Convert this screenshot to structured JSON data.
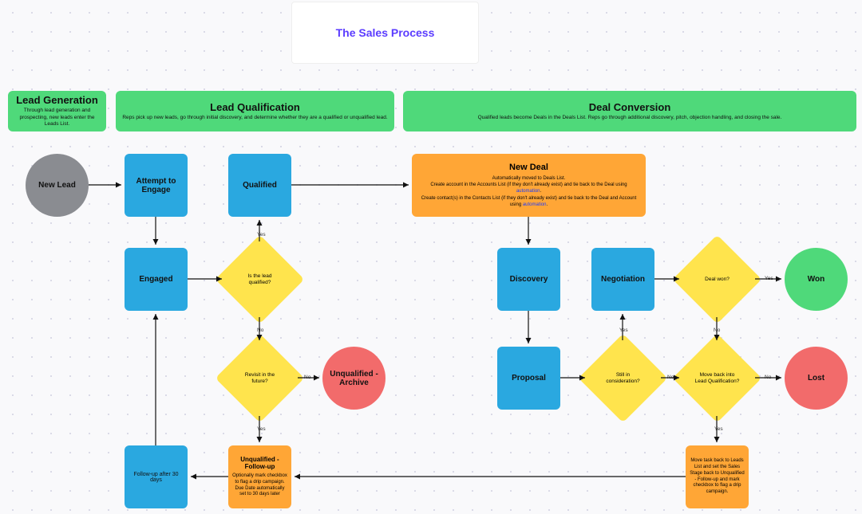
{
  "title": "The Sales Process",
  "headers": {
    "leadGen": {
      "title": "Lead Generation",
      "sub": "Through lead generation and prospecting, new leads enter the Leads List."
    },
    "leadQual": {
      "title": "Lead Qualification",
      "sub": "Reps pick up new leads, go through initial discovery, and determine whether they are a qualified or unqualified lead."
    },
    "dealConv": {
      "title": "Deal Conversion",
      "sub": "Qualified leads become Deals in the Deals List. Reps go through additional discovery, pitch, objection handling, and closing the sale."
    }
  },
  "nodes": {
    "newLead": "New Lead",
    "attempt": "Attempt to Engage",
    "engaged": "Engaged",
    "qualified": "Qualified",
    "isQualified": "Is the lead qualified?",
    "revisit": "Revisit in the future?",
    "archive": "Unqualified - Archive",
    "followup30": "Follow-up after 30 days",
    "unqFollow": {
      "title": "Unqualified - Follow-up",
      "sub": "Optionally mark checkbox to flag a drip campaign. Due Date automatically set to 30 days later"
    },
    "newDeal": {
      "title": "New Deal",
      "line1": "Automatically moved to Deals List.",
      "line2a": "Create account in the Accounts List (if they don't already exist) and tie back to the Deal using ",
      "link1": "automation",
      "line2b": ".",
      "line3a": "Create contact(s) in the Contacts List (if they don't already exist) and tie back to the Deal and Account using ",
      "link2": "automation",
      "line3b": "."
    },
    "discovery": "Discovery",
    "negotiation": "Negotiation",
    "proposal": "Proposal",
    "stillConsider": "Still in consideration?",
    "dealWon": "Deal won?",
    "moveBack": "Move back into Lead Qualification?",
    "won": "Won",
    "lost": "Lost",
    "moveTask": "Move task back to Leads List and set the Sales Stage back to Unqualified - Follow-up and mark checkbox to flag a drip campaign."
  },
  "labels": {
    "yes": "Yes",
    "no": "No"
  }
}
